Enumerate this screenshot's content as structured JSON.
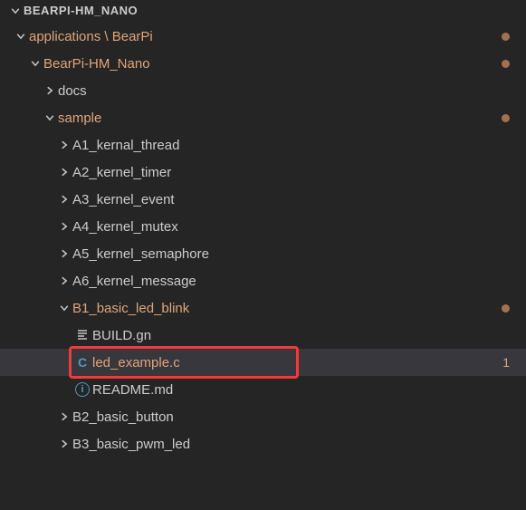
{
  "header": {
    "title": "BEARPI-HM_NANO"
  },
  "tree": {
    "root": {
      "label": "applications \\ BearPi",
      "children": {
        "nano": {
          "label": "BearPi-HM_Nano",
          "docs": {
            "label": "docs"
          },
          "sample": {
            "label": "sample",
            "a1": {
              "label": "A1_kernal_thread"
            },
            "a2": {
              "label": "A2_kernel_timer"
            },
            "a3": {
              "label": "A3_kernel_event"
            },
            "a4": {
              "label": "A4_kernel_mutex"
            },
            "a5": {
              "label": "A5_kernel_semaphore"
            },
            "a6": {
              "label": "A6_kernel_message"
            },
            "b1": {
              "label": "B1_basic_led_blink",
              "build": {
                "label": "BUILD.gn"
              },
              "led": {
                "label": "led_example.c",
                "badge": "1"
              },
              "readme": {
                "label": "README.md"
              }
            },
            "b2": {
              "label": "B2_basic_button"
            },
            "b3": {
              "label": "B3_basic_pwm_led"
            }
          }
        }
      }
    }
  }
}
